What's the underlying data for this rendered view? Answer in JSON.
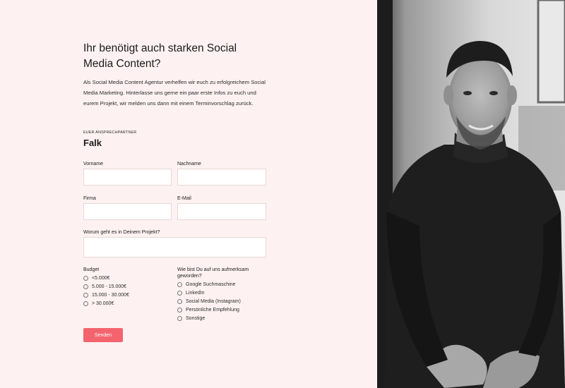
{
  "heading": "Ihr benötigt auch starken Social Media Content?",
  "intro": "Als Social Media Content Agentur verhelfen wir euch zu erfolgreichem Social Media Marketing. Hinterlasse uns gerne ein paar erste Infos zu euch und eurem Projekt, wir melden uns dann mit einem Terminvorschlag zurück.",
  "contact": {
    "eyebrow": "EUER ANSPRECHPARTNER",
    "name": "Falk"
  },
  "form": {
    "vorname_label": "Vorname",
    "nachname_label": "Nachname",
    "firma_label": "Firma",
    "email_label": "E-Mail",
    "projekt_label": "Worum geht es in Deinem Projekt?",
    "budget_label": "Budget",
    "budget_options": [
      "<5.000€",
      "5.000 - 15.000€",
      "15.000 - 30.000€",
      "> 30.000€"
    ],
    "source_label": "Wie bist Du auf uns aufmerksam geworden?",
    "source_options": [
      "Google Suchmaschine",
      "LinkedIn",
      "Social Media (Instagram)",
      "Persönliche Empfehlung",
      "Sonstige"
    ],
    "submit_label": "Senden"
  },
  "colors": {
    "background": "#fdf2f1",
    "accent": "#f4646e"
  },
  "photo": {
    "icon": "person-portrait-image"
  }
}
